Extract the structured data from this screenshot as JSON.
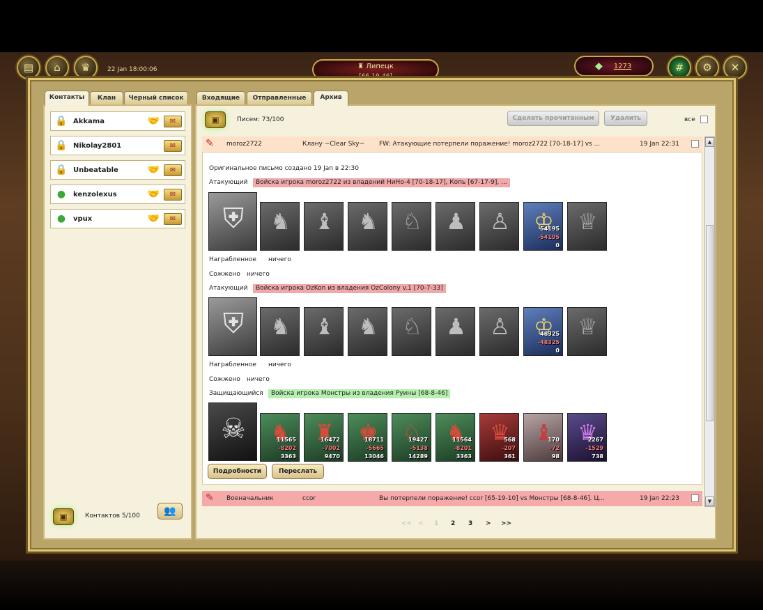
{
  "header": {
    "datetime": "22 Jan 18:00:06",
    "city": "Липецк",
    "city_coords": "[66-19-46]",
    "gold": "1273"
  },
  "left_tabs": [
    "Контакты",
    "Клан",
    "Черный список"
  ],
  "right_tabs": [
    "Входящие",
    "Отправленные",
    "Архив"
  ],
  "contacts": [
    {
      "name": "Akkama",
      "icon": "lock-icon"
    },
    {
      "name": "Nikolay2801",
      "icon": "lock-icon"
    },
    {
      "name": "Unbeatable",
      "icon": "lock-icon"
    },
    {
      "name": "kenzolexus",
      "icon": "online-icon"
    },
    {
      "name": "vpux",
      "icon": "online-icon"
    }
  ],
  "contacts_count": "Контактов 5/100",
  "toolbar": {
    "letters": "Писем: 73/100",
    "mark_read": "Сделать прочитанным",
    "delete": "Удалить",
    "all": "все"
  },
  "message1": {
    "from": "moroz2722",
    "to": "Клану ~Clear Sky~",
    "subject": "FW: Атакующие потерпели поражение! moroz2722 [70-18-17] vs ...",
    "date": "19 Jan 22:31"
  },
  "body": {
    "origin": "Оригинальное письмо создано 19 Jan в 22:30",
    "attacker_label": "Атакующий",
    "defender_label": "Защищающийся",
    "army1": "Войска игрока moroz2722 из владений НиНо-4 [70-18-17], Копь [67-17-9], ...",
    "army2": "Войска игрока OzKon из владения OzColony v.1 [70-7-33]",
    "army3": "Войска игрока Монстры из владения Руины [68-8-46]",
    "loot_label": "Награбленное",
    "burn_label": "Сожжено",
    "nothing": "ничего",
    "details": "Подробности",
    "forward": "Переслать",
    "army1_hero": [
      "54195",
      "-54195",
      "0"
    ],
    "army2_hero": [
      "48325",
      "-48325",
      "0"
    ],
    "monsters": [
      [
        "11565",
        "-8202",
        "3363"
      ],
      [
        "16472",
        "-7002",
        "9470"
      ],
      [
        "18711",
        "-5665",
        "13046"
      ],
      [
        "19427",
        "-5138",
        "14289"
      ],
      [
        "11564",
        "-8201",
        "3363"
      ],
      [
        "568",
        "-207",
        "361"
      ],
      [
        "170",
        "-72",
        "98"
      ],
      [
        "2267",
        "-1529",
        "738"
      ]
    ]
  },
  "message2": {
    "from": "Военачальник",
    "to": "ccor",
    "subject": "Вы потерпели поражение! ccor [65-19-10] vs Монстры [68-8-46]. Ц...",
    "date": "19 Jan 22:23"
  },
  "pager": {
    "first": "<<",
    "prev": "<",
    "p1": "1",
    "p2": "2",
    "p3": "3",
    "next": ">",
    "last": ">>"
  },
  "colors": {
    "attacker_hl": "#f1a8a8",
    "defender_hl": "#b6f0b0",
    "msg1_bg": "#fde1c9",
    "msg2_bg": "#f6a9a9"
  }
}
